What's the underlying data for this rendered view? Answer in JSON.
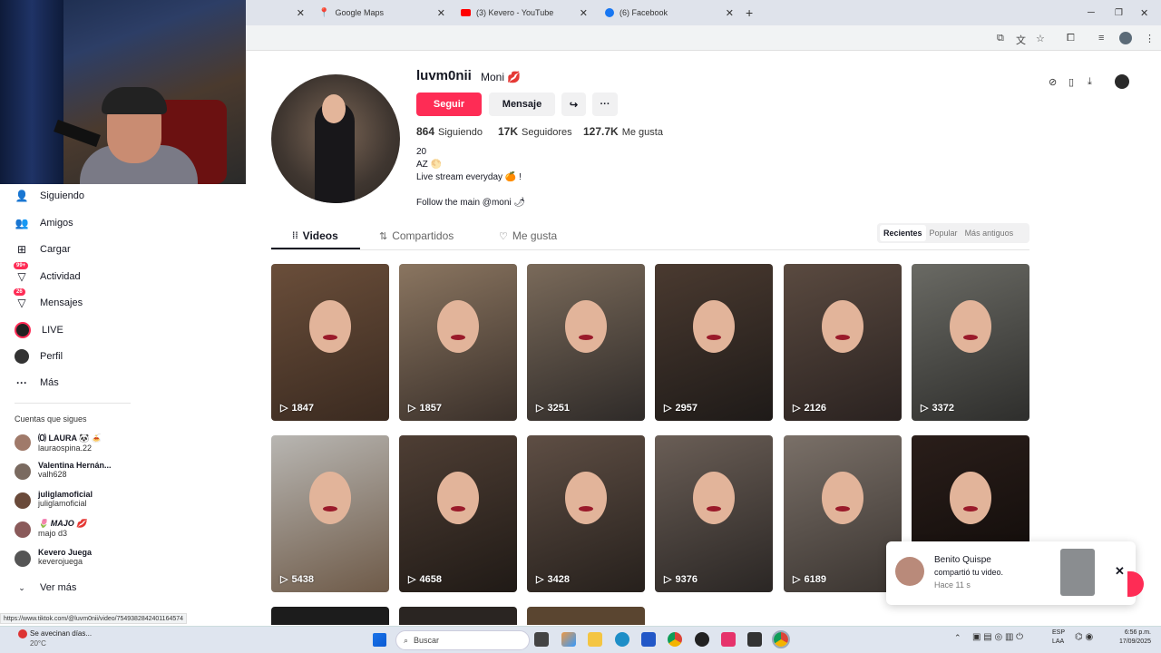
{
  "browser": {
    "tabs": [
      {
        "label": ""
      },
      {
        "label": "Google Maps"
      },
      {
        "label": "(3) Kevero - YouTube"
      },
      {
        "label": "(6) Facebook"
      }
    ],
    "new_tab": "+"
  },
  "sidebar": {
    "items": [
      {
        "label": "Siguiendo",
        "icon": "following-icon",
        "glyph": "👤"
      },
      {
        "label": "Amigos",
        "icon": "friends-icon",
        "glyph": "👥"
      },
      {
        "label": "Cargar",
        "icon": "upload-icon",
        "glyph": "⊞"
      },
      {
        "label": "Actividad",
        "icon": "activity-icon",
        "glyph": "▽",
        "badge": "99+"
      },
      {
        "label": "Mensajes",
        "icon": "messages-icon",
        "glyph": "▽",
        "badge": "26"
      },
      {
        "label": "LIVE",
        "icon": "live-icon",
        "glyph": "●"
      },
      {
        "label": "Perfil",
        "icon": "profile-icon",
        "glyph": "●"
      },
      {
        "label": "Más",
        "icon": "more-icon",
        "glyph": "···"
      }
    ],
    "following_heading": "Cuentas que sigues",
    "following": [
      {
        "name": "🄞 LAURA 🐼 🍝",
        "user": "lauraospina.22"
      },
      {
        "name": "Valentina Hernán...",
        "user": "valh628"
      },
      {
        "name": "juliglamoficial",
        "user": "juliglamoficial"
      },
      {
        "name": "🌷 MAJO 💋",
        "user": "majo d3"
      },
      {
        "name": "Kevero Juega",
        "user": "keverojuega"
      }
    ],
    "see_more": "Ver más"
  },
  "profile": {
    "username": "luvm0nii",
    "nickname": "Moni 💋",
    "follow_button": "Seguir",
    "message_button": "Mensaje",
    "stats": [
      {
        "value": "864",
        "label": "Siguiendo"
      },
      {
        "value": "17K",
        "label": "Seguidores"
      },
      {
        "value": "127.7K",
        "label": "Me gusta"
      }
    ],
    "bio": [
      "20",
      "AZ 🌕",
      "Live stream everyday 🍊 !",
      "",
      "Follow the main @moni 🌶"
    ]
  },
  "tabs": {
    "videos": "Videos",
    "reposts": "Compartidos",
    "liked": "Me gusta"
  },
  "sort": {
    "options": [
      "Recientes",
      "Popular",
      "Más antiguos"
    ],
    "selected": "Recientes"
  },
  "videos": [
    {
      "views": "1847"
    },
    {
      "views": "1857"
    },
    {
      "views": "3251"
    },
    {
      "views": "2957"
    },
    {
      "views": "2126"
    },
    {
      "views": "3372"
    },
    {
      "views": "5438"
    },
    {
      "views": "4658"
    },
    {
      "views": "3428"
    },
    {
      "views": "9376"
    },
    {
      "views": "6189"
    },
    {
      "views": ""
    }
  ],
  "toast": {
    "name": "Benito Quispe",
    "message": "compartió tu video.",
    "time": "Hace 11 s"
  },
  "status_url": "https://www.tiktok.com/@luvm0nii/video/7549382842401164574",
  "taskbar": {
    "weather_title": "Se avecinan días...",
    "weather_temp": "20°C",
    "search_placeholder": "Buscar",
    "lang": "ESP",
    "lang2": "LAA",
    "time": "6:56 p.m.",
    "date": "17/09/2025"
  }
}
